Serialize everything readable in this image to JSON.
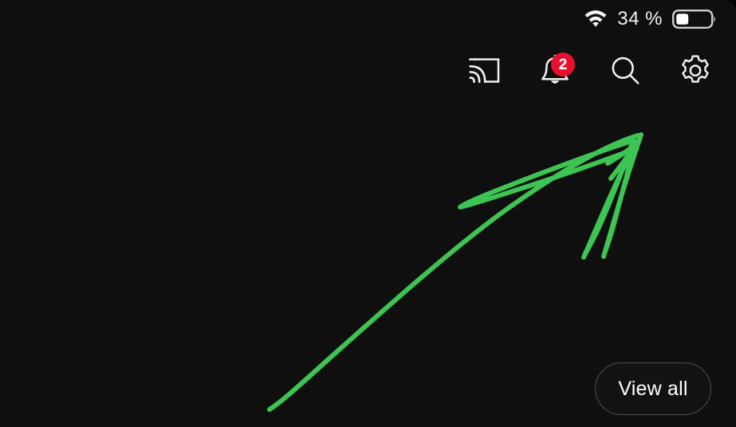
{
  "status_bar": {
    "wifi_icon": "wifi-icon",
    "battery_percent": "34 %",
    "battery_icon": "battery-icon",
    "battery_level": 34
  },
  "action_bar": {
    "items": [
      {
        "icon": "cast-icon",
        "label": "Cast"
      },
      {
        "icon": "notifications-icon",
        "label": "Notifications",
        "badge": "2"
      },
      {
        "icon": "search-icon",
        "label": "Search"
      },
      {
        "icon": "settings-gear-icon",
        "label": "Settings"
      }
    ]
  },
  "main": {
    "view_all_label": "View all"
  },
  "annotation": {
    "type": "hand-drawn-arrow",
    "color": "#3ec453",
    "description": "Green freehand arrow pointing up-right toward the settings gear icon"
  },
  "colors": {
    "background": "#0f0f0f",
    "text_primary": "#f2f2f2",
    "icon_stroke": "#ffffff",
    "badge_red": "#e8112d",
    "button_border": "#4c4c4c",
    "annotation_green": "#3ec453"
  }
}
